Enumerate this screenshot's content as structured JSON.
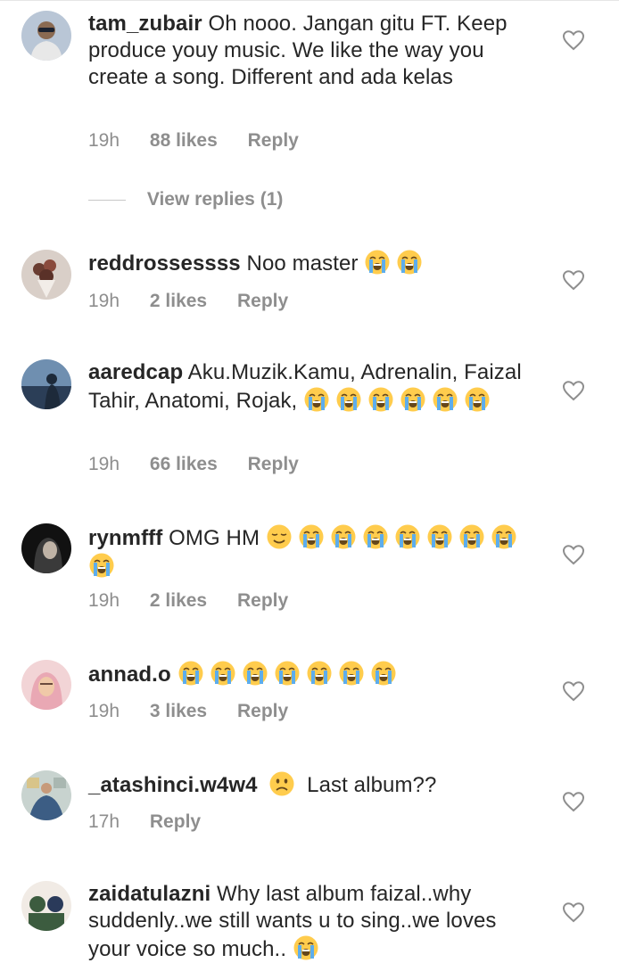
{
  "comments": [
    {
      "username": "tam_zubair",
      "text": "Oh nooo. Jangan gitu FT. Keep produce youy music. We like the way you create a song. Different and ada kelas",
      "emojis": [],
      "time": "19h",
      "likes": "88 likes",
      "reply": "Reply",
      "view_replies": "View replies (1)",
      "avatar_colors": [
        "#b9c6d6",
        "#e8e8e8",
        "#1b2230"
      ]
    },
    {
      "username": "reddrossessss",
      "text": "Noo master",
      "emojis": [
        "crying-face",
        "crying-face"
      ],
      "time": "19h",
      "likes": "2 likes",
      "reply": "Reply",
      "avatar_colors": [
        "#d9cfc8",
        "#6a3d31",
        "#f2ede8"
      ]
    },
    {
      "username": "aaredcap",
      "text": "Aku.Muzik.Kamu, Adrenalin, Faizal Tahir, Anatomi, Rojak,",
      "emojis": [
        "crying-face",
        "crying-face",
        "crying-face",
        "crying-face",
        "crying-face",
        "crying-face"
      ],
      "time": "19h",
      "likes": "66 likes",
      "reply": "Reply",
      "avatar_colors": [
        "#6f8fb0",
        "#2b3e57",
        "#c9b89a"
      ]
    },
    {
      "username": "rynmfff",
      "text": "OMG HM",
      "emojis": [
        "relieved-face",
        "crying-face",
        "crying-face",
        "crying-face",
        "crying-face",
        "crying-face",
        "crying-face",
        "crying-face",
        "crying-face"
      ],
      "time": "19h",
      "likes": "2 likes",
      "reply": "Reply",
      "avatar_colors": [
        "#3a3a3a",
        "#bfb3a6",
        "#111111"
      ]
    },
    {
      "username": "annad.o",
      "text": "",
      "emojis": [
        "crying-face",
        "crying-face",
        "crying-face",
        "crying-face",
        "crying-face",
        "crying-face",
        "crying-face"
      ],
      "time": "19h",
      "likes": "3 likes",
      "reply": "Reply",
      "avatar_colors": [
        "#f2d4d6",
        "#e9a8b4",
        "#6b4a3c"
      ]
    },
    {
      "username": "_atashinci.w4w4",
      "text": "Last album??",
      "emojis_before_text": [
        "slightly-frowning-face"
      ],
      "emojis": [],
      "time": "17h",
      "reply": "Reply",
      "avatar_colors": [
        "#c8d3cf",
        "#3c5d84",
        "#d8c489"
      ]
    },
    {
      "username": "zaidatulazni",
      "text": "Why last album faizal..why suddenly..we still wants u to sing..we loves your voice so much..",
      "emojis": [
        "crying-face"
      ],
      "avatar_colors": [
        "#3c5c3f",
        "#f1ebe5",
        "#2a3a5a"
      ]
    }
  ],
  "icons": {
    "like": "heart-outline-icon",
    "emoji_colors": {
      "face": "#ffcc4d",
      "tears": "#5dadec",
      "mouth": "#65471b"
    }
  }
}
